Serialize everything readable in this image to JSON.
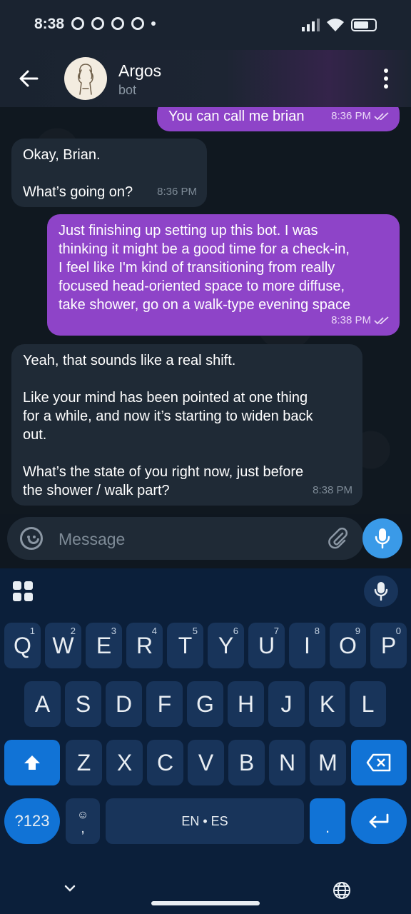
{
  "status_bar": {
    "time": "8:38"
  },
  "header": {
    "title": "Argos",
    "subtitle": "bot"
  },
  "messages": [
    {
      "direction": "out",
      "text": "You can call me brian",
      "time": "8:36 PM"
    },
    {
      "direction": "in",
      "text": "Okay, Brian.\n\nWhat’s going on?",
      "time": "8:36 PM"
    },
    {
      "direction": "out",
      "text": "Just finishing up setting up this bot. I was\nthinking it might be a good time for a check-in,\nI feel like I'm kind of transitioning from really\nfocused head-oriented space to more diffuse,\ntake shower, go on a walk-type evening space",
      "time": "8:38 PM"
    },
    {
      "direction": "in",
      "text": "Yeah, that sounds like a real shift.\n\nLike your mind has been pointed at one thing\nfor a while, and now it’s starting to widen back\nout.\n\nWhat’s the state of you right now, just before\nthe shower / walk part?",
      "time": "8:38 PM"
    }
  ],
  "composer": {
    "placeholder": "Message"
  },
  "keyboard": {
    "row1": [
      {
        "key": "Q",
        "hint": "1"
      },
      {
        "key": "W",
        "hint": "2"
      },
      {
        "key": "E",
        "hint": "3"
      },
      {
        "key": "R",
        "hint": "4"
      },
      {
        "key": "T",
        "hint": "5"
      },
      {
        "key": "Y",
        "hint": "6"
      },
      {
        "key": "U",
        "hint": "7"
      },
      {
        "key": "I",
        "hint": "8"
      },
      {
        "key": "O",
        "hint": "9"
      },
      {
        "key": "P",
        "hint": "0"
      }
    ],
    "row2": [
      "A",
      "S",
      "D",
      "F",
      "G",
      "H",
      "J",
      "K",
      "L"
    ],
    "row3": [
      "Z",
      "X",
      "C",
      "V",
      "B",
      "N",
      "M"
    ],
    "symbols_key": "?123",
    "comma_key": ",",
    "space_label": "EN • ES",
    "period_key": "."
  },
  "colors": {
    "outgoing_bubble": "#8e44c8",
    "incoming_bubble": "#1f2a36",
    "accent": "#3a9ae8",
    "keyboard_bg": "#0b1f3a",
    "key_bg": "#18345a",
    "key_blue": "#1173d6"
  }
}
